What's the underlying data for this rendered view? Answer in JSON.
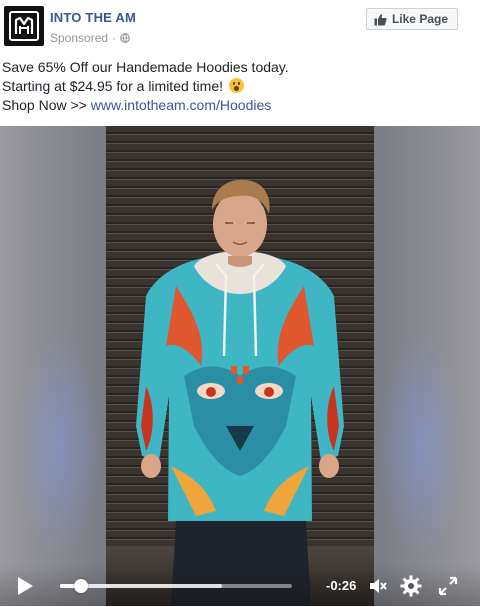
{
  "header": {
    "page_name": "INTO THE AM",
    "sponsored_label": "Sponsored",
    "sponsored_separator": "·",
    "like_button_label": "Like Page",
    "avatar_icon": "into-the-am-logo-icon"
  },
  "post": {
    "line1": "Save 65% Off our Handemade Hoodies today.",
    "line2": "Starting at $24.95 for a limited time!",
    "line2_emoji": "surprised-face-emoji",
    "line3_prefix": "Shop Now >> ",
    "line3_link": "www.intotheam.com/Hoodies"
  },
  "video": {
    "time_remaining": "-0:26",
    "progress_played": 0.09,
    "progress_buffered": 0.7,
    "icons": [
      "play-icon",
      "mute-icon",
      "gear-icon",
      "fullscreen-icon"
    ]
  },
  "colors": {
    "link": "#365899",
    "meta": "#90949c",
    "text": "#1d2129",
    "hoodie_teal": "#3fb6c4"
  }
}
